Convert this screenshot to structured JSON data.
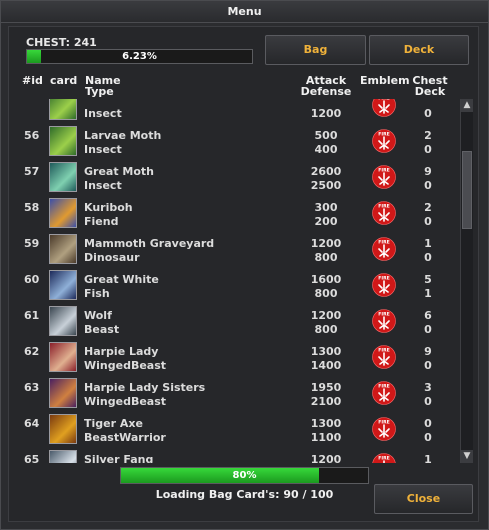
{
  "window": {
    "title": "Menu"
  },
  "chest": {
    "label": "CHEST: 241",
    "progress_text": "6.23%",
    "progress": 0.0623
  },
  "buttons": {
    "bag": "Bag",
    "deck": "Deck",
    "close": "Close"
  },
  "columns": {
    "id": "#id",
    "card": "card",
    "name_type": [
      "Name",
      "Type"
    ],
    "atk_def": [
      "Attack",
      "Defense"
    ],
    "emblem": "Emblem",
    "chest_deck": [
      "Chest",
      "Deck"
    ]
  },
  "emblem_text": "FIRE",
  "rows": [
    {
      "id": "",
      "name": "",
      "type": "Insect",
      "attack": "",
      "defense": "1200",
      "chest": "",
      "deck": "0",
      "art": "green"
    },
    {
      "id": "56",
      "name": "Larvae Moth",
      "type": "Insect",
      "attack": "500",
      "defense": "400",
      "chest": "2",
      "deck": "0",
      "art": "green"
    },
    {
      "id": "57",
      "name": "Great Moth",
      "type": "Insect",
      "attack": "2600",
      "defense": "2500",
      "chest": "9",
      "deck": "0",
      "art": "teal"
    },
    {
      "id": "58",
      "name": "Kuriboh",
      "type": "Fiend",
      "attack": "300",
      "defense": "200",
      "chest": "2",
      "deck": "0",
      "art": "blue"
    },
    {
      "id": "59",
      "name": "Mammoth Graveyard",
      "type": "Dinosaur",
      "attack": "1200",
      "defense": "800",
      "chest": "1",
      "deck": "0",
      "art": "brown"
    },
    {
      "id": "60",
      "name": "Great White",
      "type": "Fish",
      "attack": "1600",
      "defense": "800",
      "chest": "5",
      "deck": "1",
      "art": "navy"
    },
    {
      "id": "61",
      "name": "Wolf",
      "type": "Beast",
      "attack": "1200",
      "defense": "800",
      "chest": "6",
      "deck": "0",
      "art": "gray"
    },
    {
      "id": "62",
      "name": "Harpie Lady",
      "type": "WingedBeast",
      "attack": "1300",
      "defense": "1400",
      "chest": "9",
      "deck": "0",
      "art": "red"
    },
    {
      "id": "63",
      "name": "Harpie Lady Sisters",
      "type": "WingedBeast",
      "attack": "1950",
      "defense": "2100",
      "chest": "3",
      "deck": "0",
      "art": "purple"
    },
    {
      "id": "64",
      "name": "Tiger Axe",
      "type": "BeastWarrior",
      "attack": "1300",
      "defense": "1100",
      "chest": "0",
      "deck": "0",
      "art": "orange"
    },
    {
      "id": "65",
      "name": "Silver Fang",
      "type": "",
      "attack": "1200",
      "defense": "",
      "chest": "1",
      "deck": "",
      "art": "silver"
    }
  ],
  "loading": {
    "progress_text": "80%",
    "progress": 0.8,
    "status": "Loading Bag Card's: 90 / 100"
  },
  "colors": {
    "accent": "#f0b23a",
    "progress": "#2fcc32",
    "emblem": "#d01818"
  }
}
